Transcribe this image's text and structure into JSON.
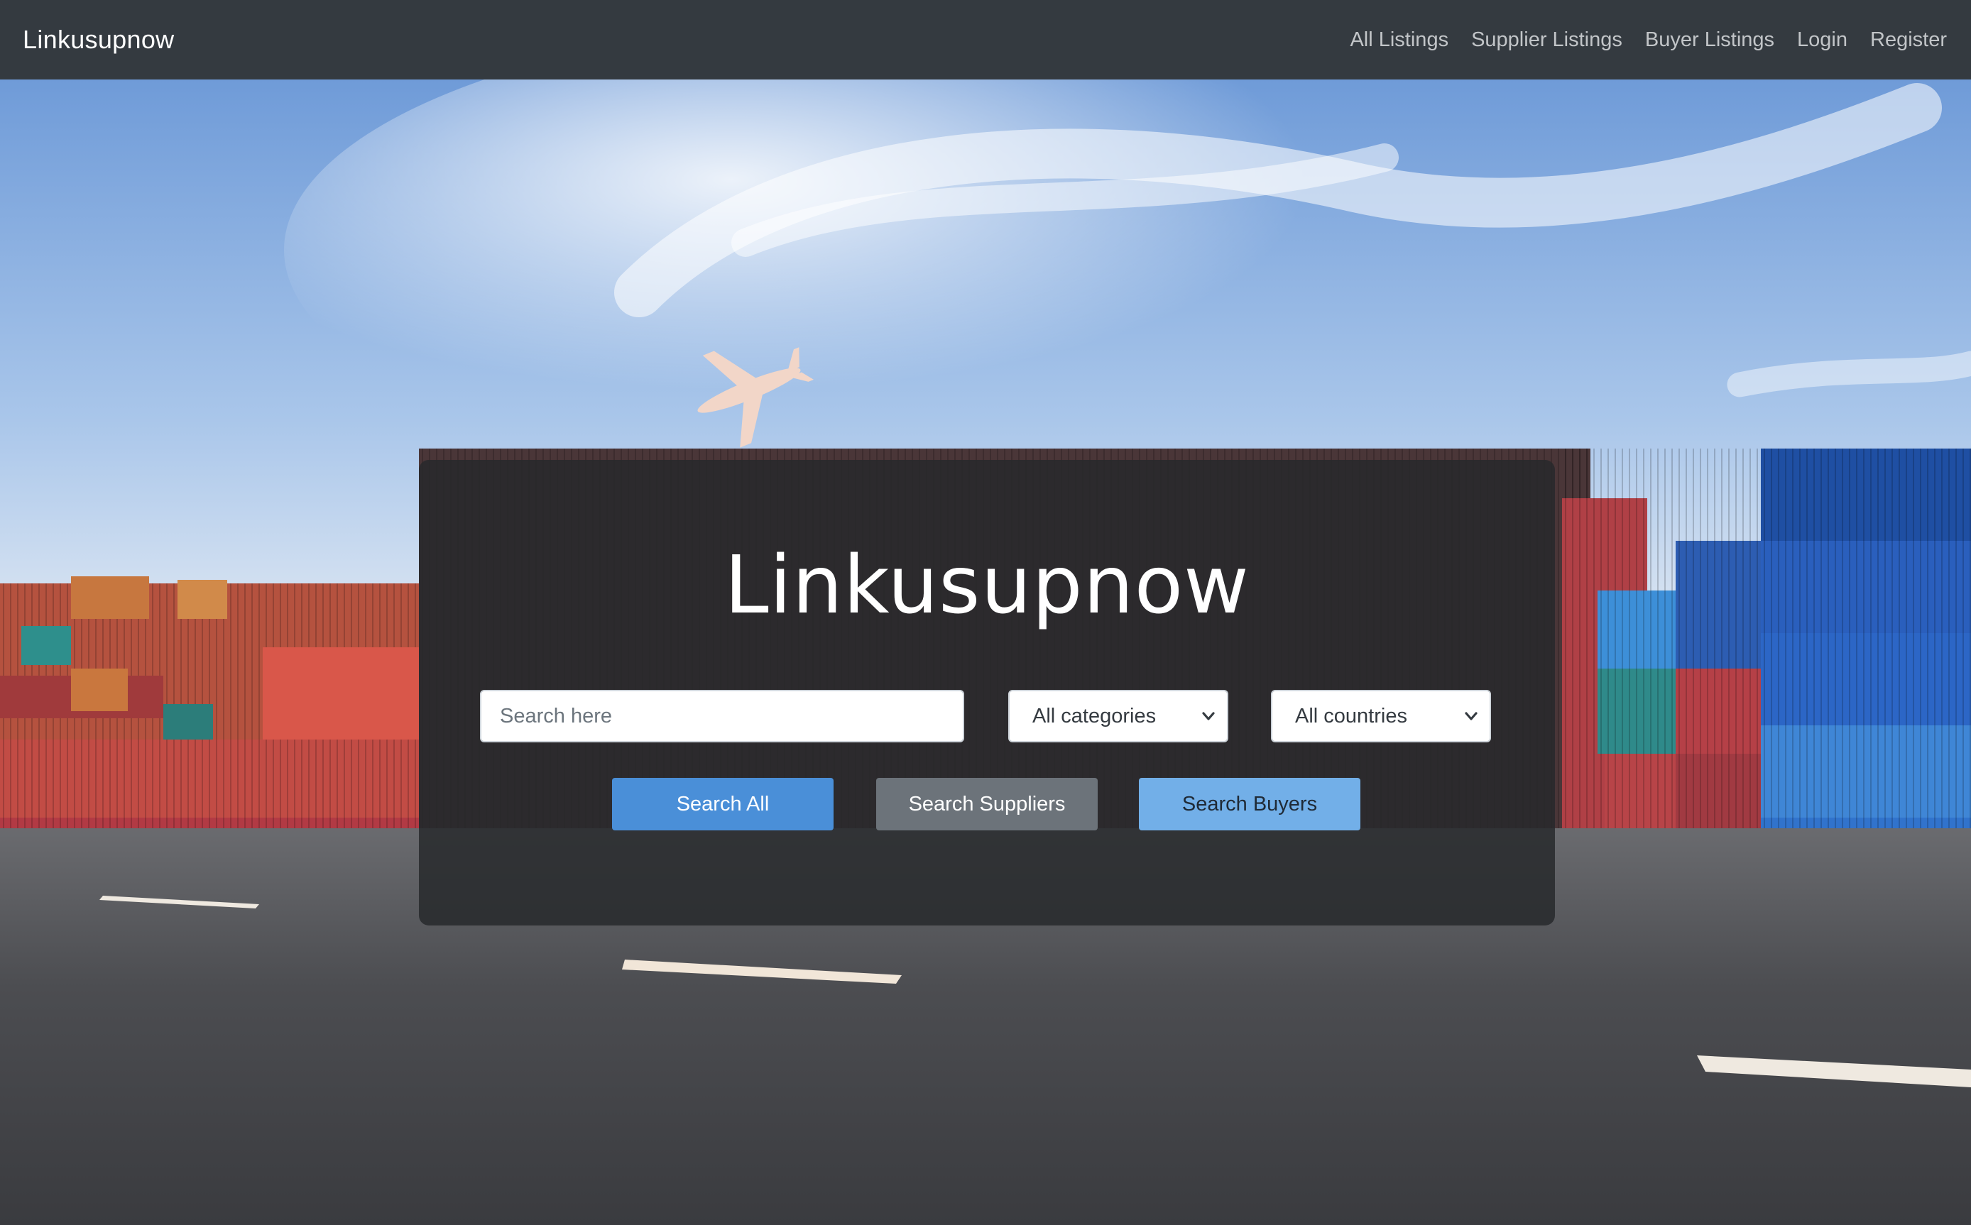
{
  "navbar": {
    "brand": "Linkusupnow",
    "links": [
      "All Listings",
      "Supplier Listings",
      "Buyer Listings",
      "Login",
      "Register"
    ]
  },
  "hero": {
    "title": "Linkusupnow",
    "search": {
      "placeholder": "Search here",
      "value": ""
    },
    "category_select": {
      "selected": "All categories"
    },
    "country_select": {
      "selected": "All countries"
    },
    "buttons": {
      "search_all": "Search All",
      "search_suppliers": "Search Suppliers",
      "search_buyers": "Search Buyers"
    }
  },
  "colors": {
    "navbar_bg": "#343a40",
    "primary": "#4a8fd8",
    "secondary": "#6c737a",
    "info": "#72afe8",
    "panel_bg": "rgba(38,40,43,0.84)"
  },
  "icons": [
    "chevron-down-icon",
    "airplane-icon"
  ]
}
